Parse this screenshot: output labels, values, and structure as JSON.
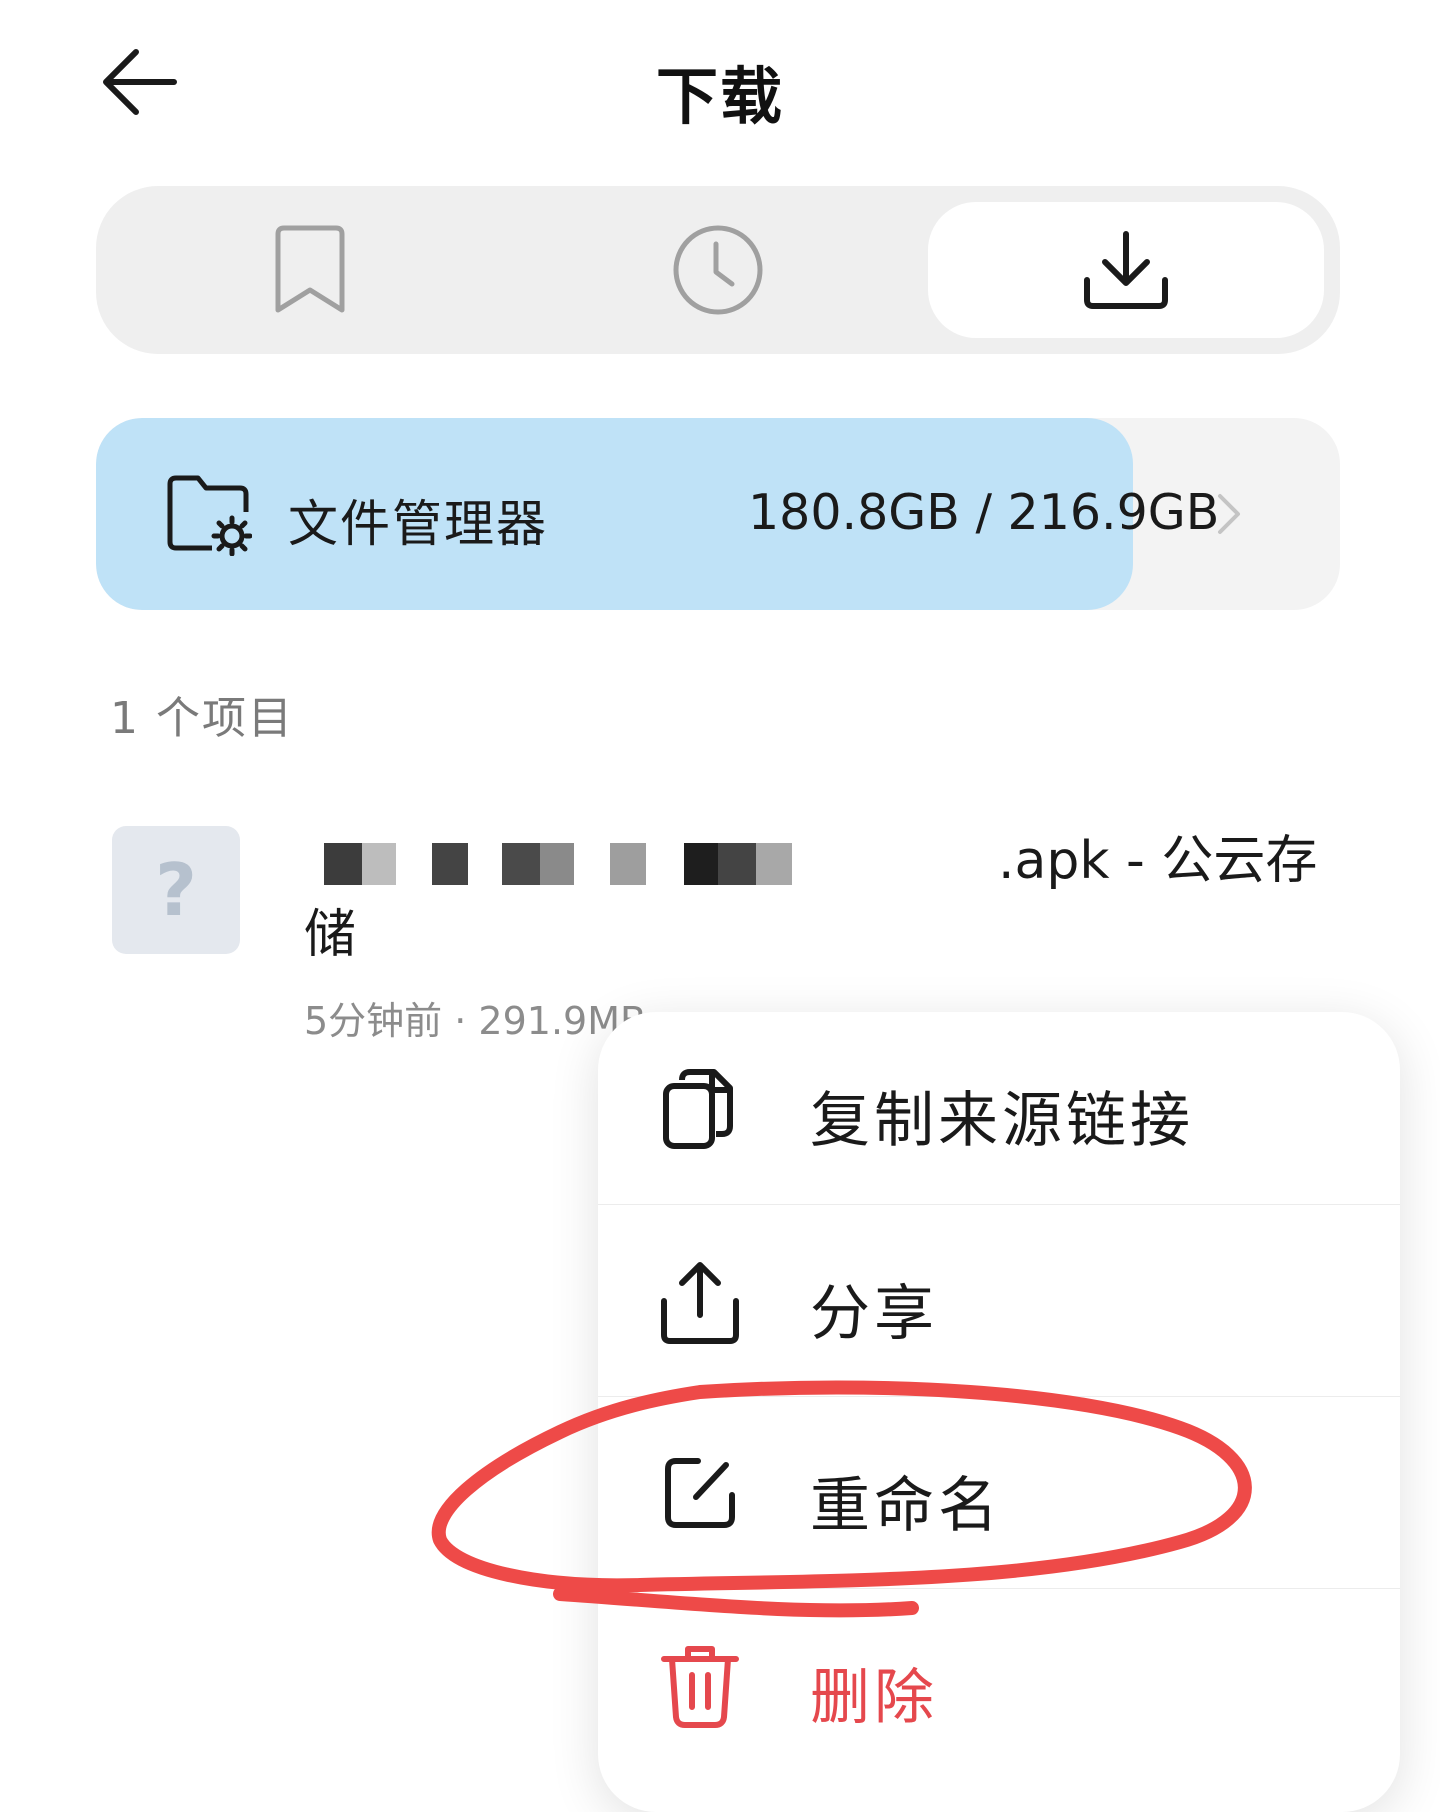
{
  "header": {
    "title": "下载"
  },
  "tabs": [
    {
      "name": "bookmarks",
      "icon": "bookmark-icon",
      "active": false
    },
    {
      "name": "history",
      "icon": "clock-icon",
      "active": false
    },
    {
      "name": "downloads",
      "icon": "download-icon",
      "active": true
    }
  ],
  "storage": {
    "label": "文件管理器",
    "size_text": "180.8GB / 216.9GB",
    "used_fraction": 0.834,
    "icon": "folder-settings-icon"
  },
  "list": {
    "count_label": "1 个项目",
    "items": [
      {
        "thumb_glyph": "?",
        "name_suffix": ".apk - 公云存储",
        "meta": "5分钟前 · 291.9MB"
      }
    ]
  },
  "context_menu": {
    "items": [
      {
        "label": "复制来源链接",
        "icon": "copy-icon"
      },
      {
        "label": "分享",
        "icon": "share-icon"
      },
      {
        "label": "重命名",
        "icon": "rename-icon"
      },
      {
        "label": "删除",
        "icon": "trash-icon",
        "color": "#e5484d"
      }
    ]
  },
  "colors": {
    "storage_fill": "#bfe2f7",
    "danger": "#e5484d",
    "annotation": "#ee4a48"
  }
}
